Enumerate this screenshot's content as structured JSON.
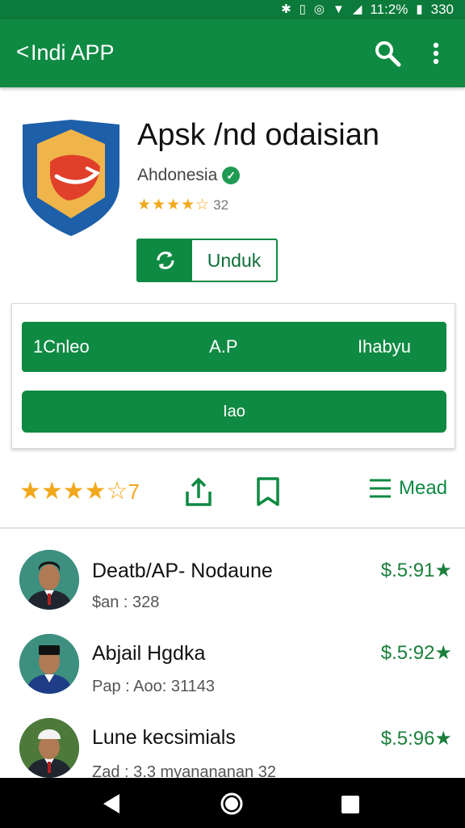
{
  "status_bar": {
    "time": "11:2%",
    "battery": "330",
    "icons": [
      "bluetooth-icon",
      "vibrate-icon",
      "alarm-icon",
      "wifi-icon",
      "signal-icon",
      "battery-icon"
    ]
  },
  "app_bar": {
    "back_glyph": "<",
    "title": "Indi APP",
    "icons": [
      "search-icon",
      "more-vert-icon"
    ]
  },
  "app": {
    "name": "Apsk /nd odaisian",
    "developer": "Ahdonesia",
    "rating_count": "32",
    "stars": 4.5,
    "install_label": "Unduk"
  },
  "action_card": {
    "row1": [
      "1Cnleo",
      "A.P",
      "Ihabyu"
    ],
    "row2": "Iao"
  },
  "rating_strip": {
    "stars_value": "7",
    "menu_label": "Mead"
  },
  "list": [
    {
      "title": "Deatb/AP- Nodaune",
      "subtitle": "$an : 328",
      "price": "$.5:91★"
    },
    {
      "title": "Abjail Hgdka",
      "subtitle": "Pap : Aoo: 31143",
      "price": "$.5:92★"
    },
    {
      "title": "Lune kecsimials",
      "subtitle": "Zad : 3.3 myanananan 32",
      "price": "$.5:96★"
    }
  ],
  "colors": {
    "primary": "#0f8a43",
    "status_bar": "#0c7a3a",
    "star": "#f2a81d",
    "price": "#1b7f3c"
  }
}
